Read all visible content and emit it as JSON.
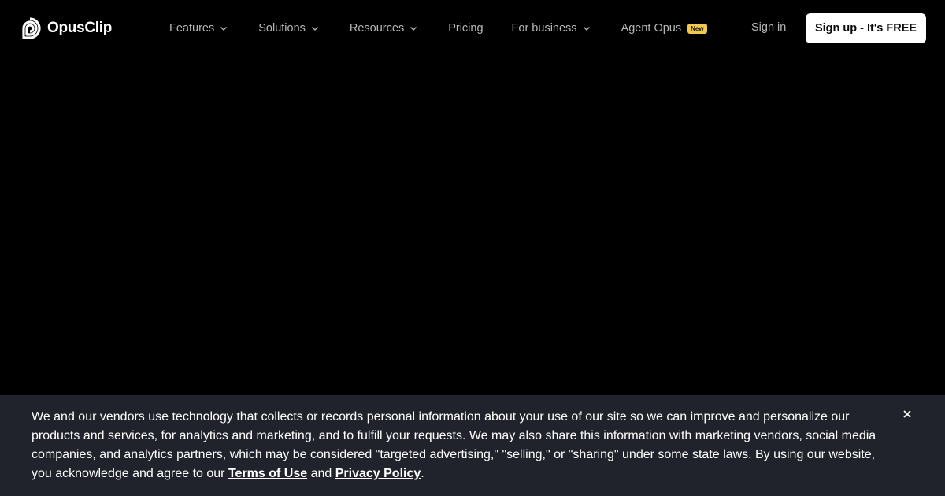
{
  "brand": {
    "name": "OpusClip",
    "icon": "opusclip-logo-icon"
  },
  "nav": {
    "items": [
      {
        "label": "Features",
        "has_dropdown": true
      },
      {
        "label": "Solutions",
        "has_dropdown": true
      },
      {
        "label": "Resources",
        "has_dropdown": true
      },
      {
        "label": "Pricing",
        "has_dropdown": false
      },
      {
        "label": "For business",
        "has_dropdown": true
      },
      {
        "label": "Agent Opus",
        "has_dropdown": false,
        "badge": "New"
      }
    ],
    "sign_in": "Sign in",
    "sign_up": "Sign up - It's FREE"
  },
  "cookie_banner": {
    "text_before": "We and our vendors use technology that collects or records personal information about your use of our site so we can improve and personalize our products and services, for analytics and marketing, and to fulfill your requests. We may also share this information with marketing vendors, social media companies, and analytics partners, which may be considered \"targeted advertising,\" \"selling,\" or \"sharing\" under some state laws. By using our website, you acknowledge and agree to our ",
    "terms_link": "Terms of Use",
    "between": " and ",
    "privacy_link": "Privacy Policy",
    "after": ".",
    "close_icon": "close-icon"
  },
  "colors": {
    "background": "#000000",
    "nav_text": "#b7b7b7",
    "banner_bg": "#20232b",
    "badge_bg": "#f2c94c",
    "signup_bg": "#ffffff"
  }
}
